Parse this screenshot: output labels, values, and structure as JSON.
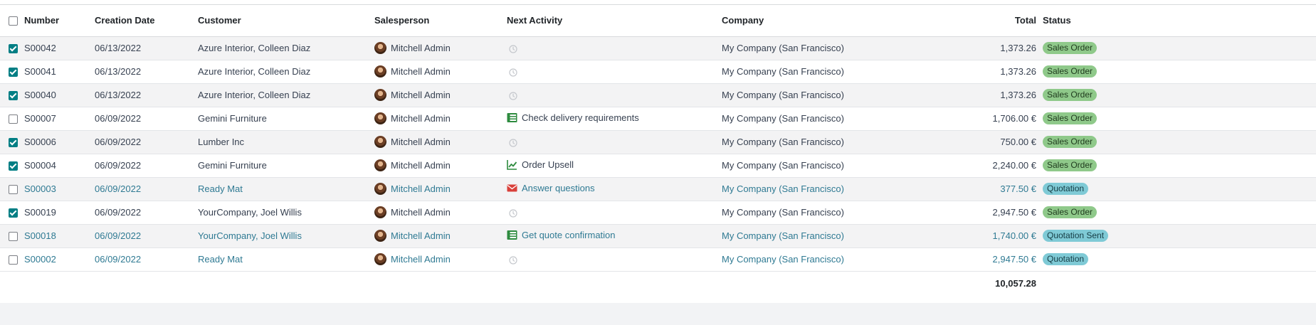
{
  "columns": {
    "number": "Number",
    "creation_date": "Creation Date",
    "customer": "Customer",
    "salesperson": "Salesperson",
    "next_activity": "Next Activity",
    "company": "Company",
    "total": "Total",
    "status": "Status"
  },
  "rows": [
    {
      "checked": true,
      "number": "S00042",
      "date": "06/13/2022",
      "customer": "Azure Interior, Colleen Diaz",
      "salesperson": "Mitchell Admin",
      "activity": "",
      "activity_icon": "clock-icon",
      "company": "My Company (San Francisco)",
      "total": "1,373.26",
      "status": "Sales Order",
      "status_kind": "so",
      "draft": false
    },
    {
      "checked": true,
      "number": "S00041",
      "date": "06/13/2022",
      "customer": "Azure Interior, Colleen Diaz",
      "salesperson": "Mitchell Admin",
      "activity": "",
      "activity_icon": "clock-icon",
      "company": "My Company (San Francisco)",
      "total": "1,373.26",
      "status": "Sales Order",
      "status_kind": "so",
      "draft": false
    },
    {
      "checked": true,
      "number": "S00040",
      "date": "06/13/2022",
      "customer": "Azure Interior, Colleen Diaz",
      "salesperson": "Mitchell Admin",
      "activity": "",
      "activity_icon": "clock-icon",
      "company": "My Company (San Francisco)",
      "total": "1,373.26",
      "status": "Sales Order",
      "status_kind": "so",
      "draft": false
    },
    {
      "checked": false,
      "number": "S00007",
      "date": "06/09/2022",
      "customer": "Gemini Furniture",
      "salesperson": "Mitchell Admin",
      "activity": "Check delivery requirements",
      "activity_icon": "checklist-icon",
      "company": "My Company (San Francisco)",
      "total": "1,706.00 €",
      "status": "Sales Order",
      "status_kind": "so",
      "draft": false
    },
    {
      "checked": true,
      "number": "S00006",
      "date": "06/09/2022",
      "customer": "Lumber Inc",
      "salesperson": "Mitchell Admin",
      "activity": "",
      "activity_icon": "clock-icon",
      "company": "My Company (San Francisco)",
      "total": "750.00 €",
      "status": "Sales Order",
      "status_kind": "so",
      "draft": false
    },
    {
      "checked": true,
      "number": "S00004",
      "date": "06/09/2022",
      "customer": "Gemini Furniture",
      "salesperson": "Mitchell Admin",
      "activity": "Order Upsell",
      "activity_icon": "chart-line-icon",
      "company": "My Company (San Francisco)",
      "total": "2,240.00 €",
      "status": "Sales Order",
      "status_kind": "so",
      "draft": false
    },
    {
      "checked": false,
      "number": "S00003",
      "date": "06/09/2022",
      "customer": "Ready Mat",
      "salesperson": "Mitchell Admin",
      "activity": "Answer questions",
      "activity_icon": "envelope-icon",
      "company": "My Company (San Francisco)",
      "total": "377.50 €",
      "status": "Quotation",
      "status_kind": "quote",
      "draft": true
    },
    {
      "checked": true,
      "number": "S00019",
      "date": "06/09/2022",
      "customer": "YourCompany, Joel Willis",
      "salesperson": "Mitchell Admin",
      "activity": "",
      "activity_icon": "clock-icon",
      "company": "My Company (San Francisco)",
      "total": "2,947.50 €",
      "status": "Sales Order",
      "status_kind": "so",
      "draft": false
    },
    {
      "checked": false,
      "number": "S00018",
      "date": "06/09/2022",
      "customer": "YourCompany, Joel Willis",
      "salesperson": "Mitchell Admin",
      "activity": "Get quote confirmation",
      "activity_icon": "checklist-icon",
      "company": "My Company (San Francisco)",
      "total": "1,740.00 €",
      "status": "Quotation Sent",
      "status_kind": "quote",
      "draft": true
    },
    {
      "checked": false,
      "number": "S00002",
      "date": "06/09/2022",
      "customer": "Ready Mat",
      "salesperson": "Mitchell Admin",
      "activity": "",
      "activity_icon": "clock-icon",
      "company": "My Company (San Francisco)",
      "total": "2,947.50 €",
      "status": "Quotation",
      "status_kind": "quote",
      "draft": true
    }
  ],
  "footer": {
    "total": "10,057.28"
  },
  "colors": {
    "checkbox_checked": "#017e84",
    "draft_text": "#2f7a93",
    "badge_sales_order": "#8fc98a",
    "badge_quotation": "#7fcad6"
  }
}
